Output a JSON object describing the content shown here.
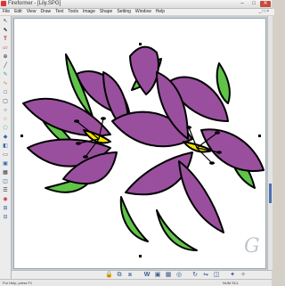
{
  "window": {
    "title": "Fireformer - [Lily.SPG]",
    "minimize": "–",
    "maximize": "□",
    "close": "✕"
  },
  "menu": {
    "items": [
      "File",
      "Edit",
      "View",
      "Draw",
      "Text",
      "Tools",
      "Image",
      "Shape",
      "Setting",
      "Window",
      "Help"
    ],
    "close_glyph": "_ □ ×"
  },
  "status": {
    "left": "For Help, press F1",
    "right": "NUM SCL"
  },
  "watermark": "G",
  "colors": {
    "petal": "#9a4f9e",
    "leaf": "#5fc448",
    "center": "#f5e400"
  }
}
